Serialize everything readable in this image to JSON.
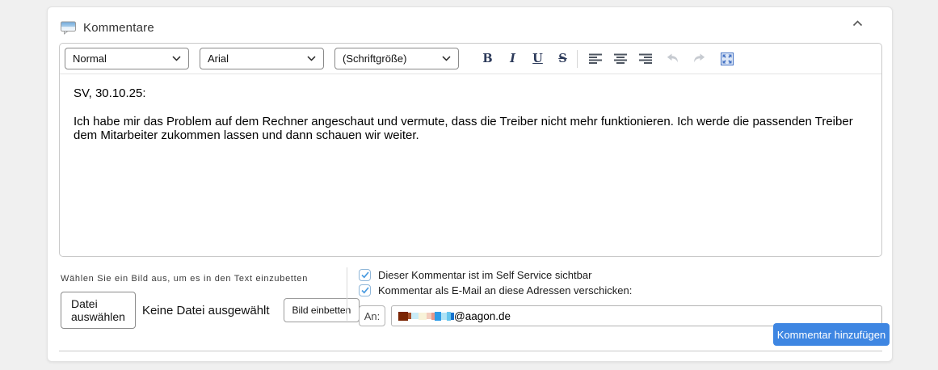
{
  "panel": {
    "title": "Kommentare"
  },
  "toolbar": {
    "style_select": "Normal",
    "font_select": "Arial",
    "size_select": "(Schriftgröße)",
    "bold": "B",
    "italic": "I",
    "underline": "U",
    "strikethrough": "S"
  },
  "editor_content": {
    "heading_line": "SV, 30.10.25:",
    "body_text": "Ich habe mir das Problem auf dem Rechner angeschaut und vermute, dass die Treiber nicht mehr funktionieren. Ich werde die passenden Treiber dem Mitarbeiter zukommen lassen und dann schauen wir weiter."
  },
  "image_embed": {
    "instruction": "Wählen Sie ein Bild aus, um es in den Text einzubetten",
    "choose_file_label": "Datei auswählen",
    "no_file_label": "Keine Datei ausgewählt",
    "embed_label": "Bild einbetten"
  },
  "options": {
    "self_service_label": "Dieser Kommentar ist im Self Service sichtbar",
    "self_service_checked": true,
    "email_label": "Kommentar als E-Mail an diese Adressen verschicken:",
    "email_checked": true,
    "recipient_label": "An:",
    "recipient_value_visible": "@aagon.de"
  },
  "actions": {
    "submit_label": "Kommentar hinzufügen"
  },
  "colors": {
    "submit_blue": "#3e86e2",
    "checkbox_check_blue": "#4a9be0",
    "toolbar_letter_navy": "#2c3a5a",
    "fullscreen_icon_blue": "#4472c4",
    "page_background": "#f0f0f0"
  }
}
